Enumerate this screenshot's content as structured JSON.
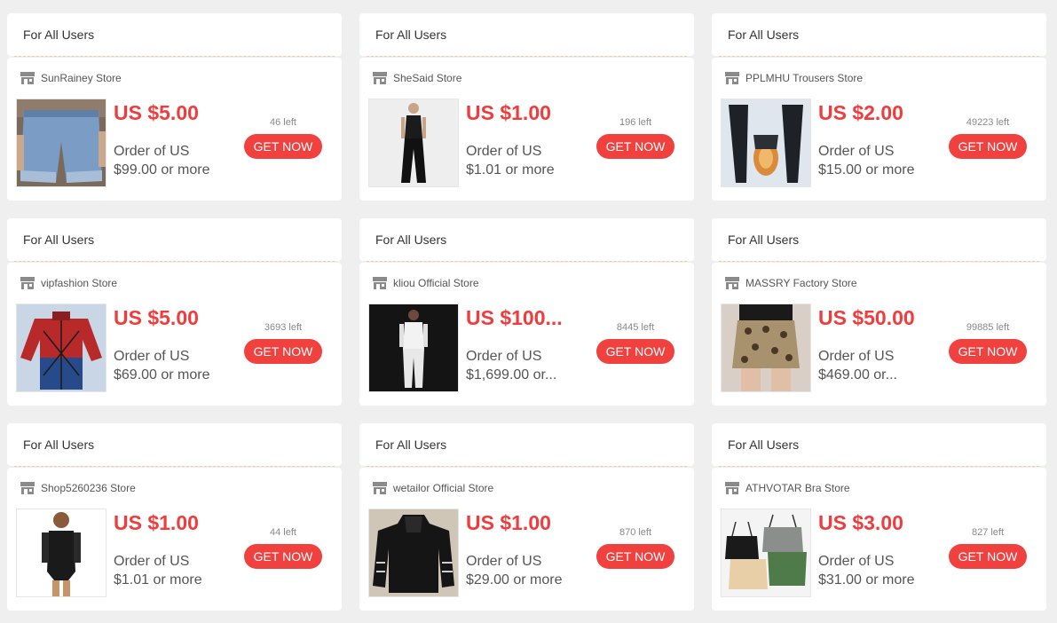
{
  "audience_label": "For All Users",
  "button_label": "GET NOW",
  "colors": {
    "accent": "#f0413f",
    "price": "#f03c3c",
    "background": "#efefef"
  },
  "coupons": [
    {
      "store": "SunRainey Store",
      "price": "US $5.00",
      "cond1": "Order of US",
      "cond2": "$99.00 or more",
      "left": "46 left",
      "image": "denim-shorts"
    },
    {
      "store": "SheSaid Store",
      "price": "US $1.00",
      "cond1": "Order of US",
      "cond2": "$1.01 or more",
      "left": "196 left",
      "image": "black-jumpsuit"
    },
    {
      "store": "PPLMHU Trousers Store",
      "price": "US $2.00",
      "cond1": "Order of US",
      "cond2": "$15.00 or more",
      "left": "49223 left",
      "image": "fleece-trousers"
    },
    {
      "store": "vipfashion Store",
      "price": "US $5.00",
      "cond1": "Order of US",
      "cond2": "$69.00 or more",
      "left": "3693 left",
      "image": "spider-shirt"
    },
    {
      "store": "kliou Official Store",
      "price": "US $100...",
      "cond1": "Order of US",
      "cond2": "$1,699.00 or...",
      "left": "8445 left",
      "image": "white-tracksuit"
    },
    {
      "store": "MASSRY Factory Store",
      "price": "US $50.00",
      "cond1": "Order of US",
      "cond2": "$469.00 or...",
      "left": "99885 left",
      "image": "leopard-skirt"
    },
    {
      "store": "Shop5260236 Store",
      "price": "US $1.00",
      "cond1": "Order of US",
      "cond2": "$1.01 or more",
      "left": "44 left",
      "image": "black-bodysuit"
    },
    {
      "store": "wetailor Official Store",
      "price": "US $1.00",
      "cond1": "Order of US",
      "cond2": "$29.00 or more",
      "left": "870 left",
      "image": "black-hoodie"
    },
    {
      "store": "ATHVOTAR Bra Store",
      "price": "US $3.00",
      "cond1": "Order of US",
      "cond2": "$31.00 or more",
      "left": "827 left",
      "image": "bra-set"
    }
  ]
}
